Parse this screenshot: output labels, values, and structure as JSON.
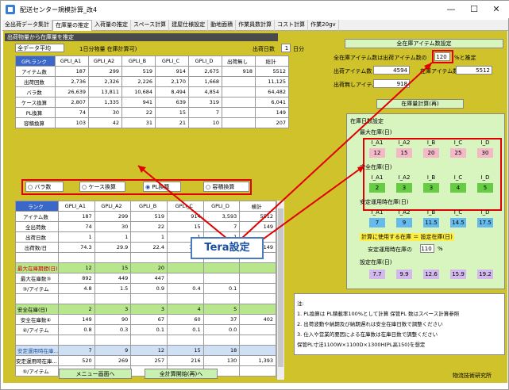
{
  "window": {
    "title": "配送センター規模計算_改4",
    "min": "—",
    "max": "☐",
    "close": "✕"
  },
  "tabs": [
    "全出荷データ集計",
    "在庫量の推定",
    "入荷量の推定",
    "スペース計算",
    "建屋仕様設定",
    "動地面積",
    "作業員数計算",
    "コスト計算",
    "作業20gv"
  ],
  "top": {
    "section_label": "出荷物量から在庫量を推定",
    "select_value": "全データ平均",
    "select2_value": "1日分物量 在庫計算可)",
    "days_label": "出荷日数",
    "days_value": "1",
    "days_unit": "日分",
    "headers": [
      "GPLランク",
      "GPLI_A1",
      "GPLI_A2",
      "GPLI_B",
      "GPLI_C",
      "GPLI_D",
      "出荷無し",
      "総計"
    ],
    "rows": [
      {
        "label": "アイテム数",
        "cells": [
          "187",
          "299",
          "519",
          "914",
          "2,675",
          "918",
          "5512"
        ]
      },
      {
        "label": "出荷回数",
        "cells": [
          "2,736",
          "2,326",
          "2,226",
          "2,170",
          "1,668",
          "",
          "11,125"
        ]
      },
      {
        "label": "バラ数",
        "cells": [
          "26,639",
          "13,811",
          "10,684",
          "8,494",
          "4,854",
          "",
          "64,482"
        ]
      },
      {
        "label": "ケース換算",
        "cells": [
          "2,807",
          "1,335",
          "941",
          "639",
          "319",
          "",
          "6,041"
        ]
      },
      {
        "label": "PL換算",
        "cells": [
          "74",
          "30",
          "22",
          "15",
          "7",
          "",
          "149"
        ]
      },
      {
        "label": "容積換算",
        "cells": [
          "103",
          "42",
          "31",
          "21",
          "10",
          "",
          "207"
        ]
      }
    ]
  },
  "radios": [
    "バラ数",
    "ケース換算",
    "PL換算",
    "容積換算"
  ],
  "radio_selected": 2,
  "lower": {
    "headers": [
      "ランク",
      "GPLI_A1",
      "GPLI_A2",
      "GPLI_B",
      "GPLI_C",
      "GPLI_D",
      "検計"
    ],
    "rows": [
      {
        "label": "アイテム数",
        "cells": [
          "187",
          "299",
          "519",
          "914",
          "3,593",
          "5512"
        ],
        "kind": "plain"
      },
      {
        "label": "全出荷数",
        "cells": [
          "74",
          "30",
          "22",
          "15",
          "7",
          "149"
        ],
        "kind": "plain"
      },
      {
        "label": "出荷日数",
        "cells": [
          "1",
          "1",
          "1",
          "1",
          "1",
          ""
        ],
        "kind": "plain"
      },
      {
        "label": "出荷数/日",
        "cells": [
          "74.3",
          "29.9",
          "22.4",
          "14.9",
          "7.5",
          "149"
        ],
        "kind": "plain"
      },
      {
        "label": "",
        "cells": [
          "",
          "",
          "",
          "",
          "",
          ""
        ],
        "kind": "blank"
      },
      {
        "label": "最大在庫期間(日)",
        "cells": [
          "12",
          "15",
          "20",
          "",
          "",
          ""
        ],
        "kind": "sec"
      },
      {
        "label": "最大在庫数③",
        "cells": [
          "892",
          "449",
          "447",
          "",
          "",
          ""
        ],
        "kind": "plain"
      },
      {
        "label": "③/アイテム",
        "cells": [
          "4.8",
          "1.5",
          "0.9",
          "0.4",
          "0.1",
          ""
        ],
        "kind": "plain"
      },
      {
        "label": "",
        "cells": [
          "",
          "",
          "",
          "",
          "",
          ""
        ],
        "kind": "blank"
      },
      {
        "label": "安全在庫(日)",
        "cells": [
          "2",
          "3",
          "3",
          "4",
          "5",
          ""
        ],
        "kind": "secg"
      },
      {
        "label": "安全在庫数④",
        "cells": [
          "149",
          "90",
          "67",
          "60",
          "37",
          "402"
        ],
        "kind": "plain"
      },
      {
        "label": "④/アイテム",
        "cells": [
          "0.8",
          "0.3",
          "0.1",
          "0.1",
          "0.0",
          ""
        ],
        "kind": "plain"
      },
      {
        "label": "",
        "cells": [
          "",
          "",
          "",
          "",
          "",
          ""
        ],
        "kind": "blank"
      },
      {
        "label": "安定運用時在庫...",
        "cells": [
          "7",
          "9",
          "12",
          "15",
          "18",
          ""
        ],
        "kind": "secb"
      },
      {
        "label": "安定運用時在庫...",
        "cells": [
          "520",
          "269",
          "257",
          "216",
          "130",
          "1,393"
        ],
        "kind": "plain"
      },
      {
        "label": "⑤/アイテム",
        "cells": [
          "",
          "",
          "",
          "",
          "",
          ""
        ],
        "kind": "plain"
      }
    ]
  },
  "right": {
    "all_items_title": "全在庫アイテム数設定",
    "all_items_label": "全在庫アイテム数は出荷アイテム数の",
    "percent_value": "120",
    "percent_unit": "%と推定",
    "shipped_items_label": "出荷アイテム数",
    "shipped_items_value": "4594",
    "stock_items_label": "在庫アイテム数",
    "stock_items_value": "5512",
    "no_ship_label": "出荷無しアイテム数",
    "no_ship_value": "918",
    "calc_title": "在庫量計算(再)",
    "days_setting_label": "在庫日数設定",
    "max_stock_label": "最大在庫(日)",
    "safety_stock_label": "安全在庫(日)",
    "stable_label": "安定運用時在庫(日)",
    "col_labels": [
      "I_A1",
      "I_A2",
      "I_B",
      "I_C",
      "I_D"
    ],
    "max_vals": [
      "12",
      "15",
      "20",
      "25",
      "30"
    ],
    "safety_vals": [
      "2",
      "3",
      "3",
      "4",
      "5"
    ],
    "stable_vals": [
      "7",
      "9",
      "11.5",
      "14.5",
      "17.5"
    ],
    "calc_stock_label": "計算に使用する在庫 ＝ 設定在庫(日)",
    "stable_ratio_label": "安定運用時在庫の",
    "stable_ratio_value": "110",
    "stable_ratio_unit": "%",
    "set_stock_label": "設定在庫(日)",
    "set_vals": [
      "7.7",
      "9.9",
      "12.6",
      "15.9",
      "19.2"
    ]
  },
  "notes": {
    "head": "注:",
    "lines": [
      "1. PL換算は PL積載率100%として計算 保管PL 数はスペース計算参照",
      "2. 出荷波動や納期及び納期遅れは安全在庫日数で調整ください",
      "3. 仕入や営業的要因による在庫数は在庫日数で調整ください",
      "保管PL寸法1100W×1100D×1300H(PL高150)を想定"
    ]
  },
  "buttons": {
    "menu": "メニュー画面へ",
    "calc_all": "全計算開始(再)へ"
  },
  "footer": "物流技術研究所",
  "callout": "Tera設定",
  "colors": {
    "panel": "#cfc22a",
    "header_dark": "#4a4a4a",
    "selected": "#3b67c9",
    "highlight_red": "#e00000"
  }
}
